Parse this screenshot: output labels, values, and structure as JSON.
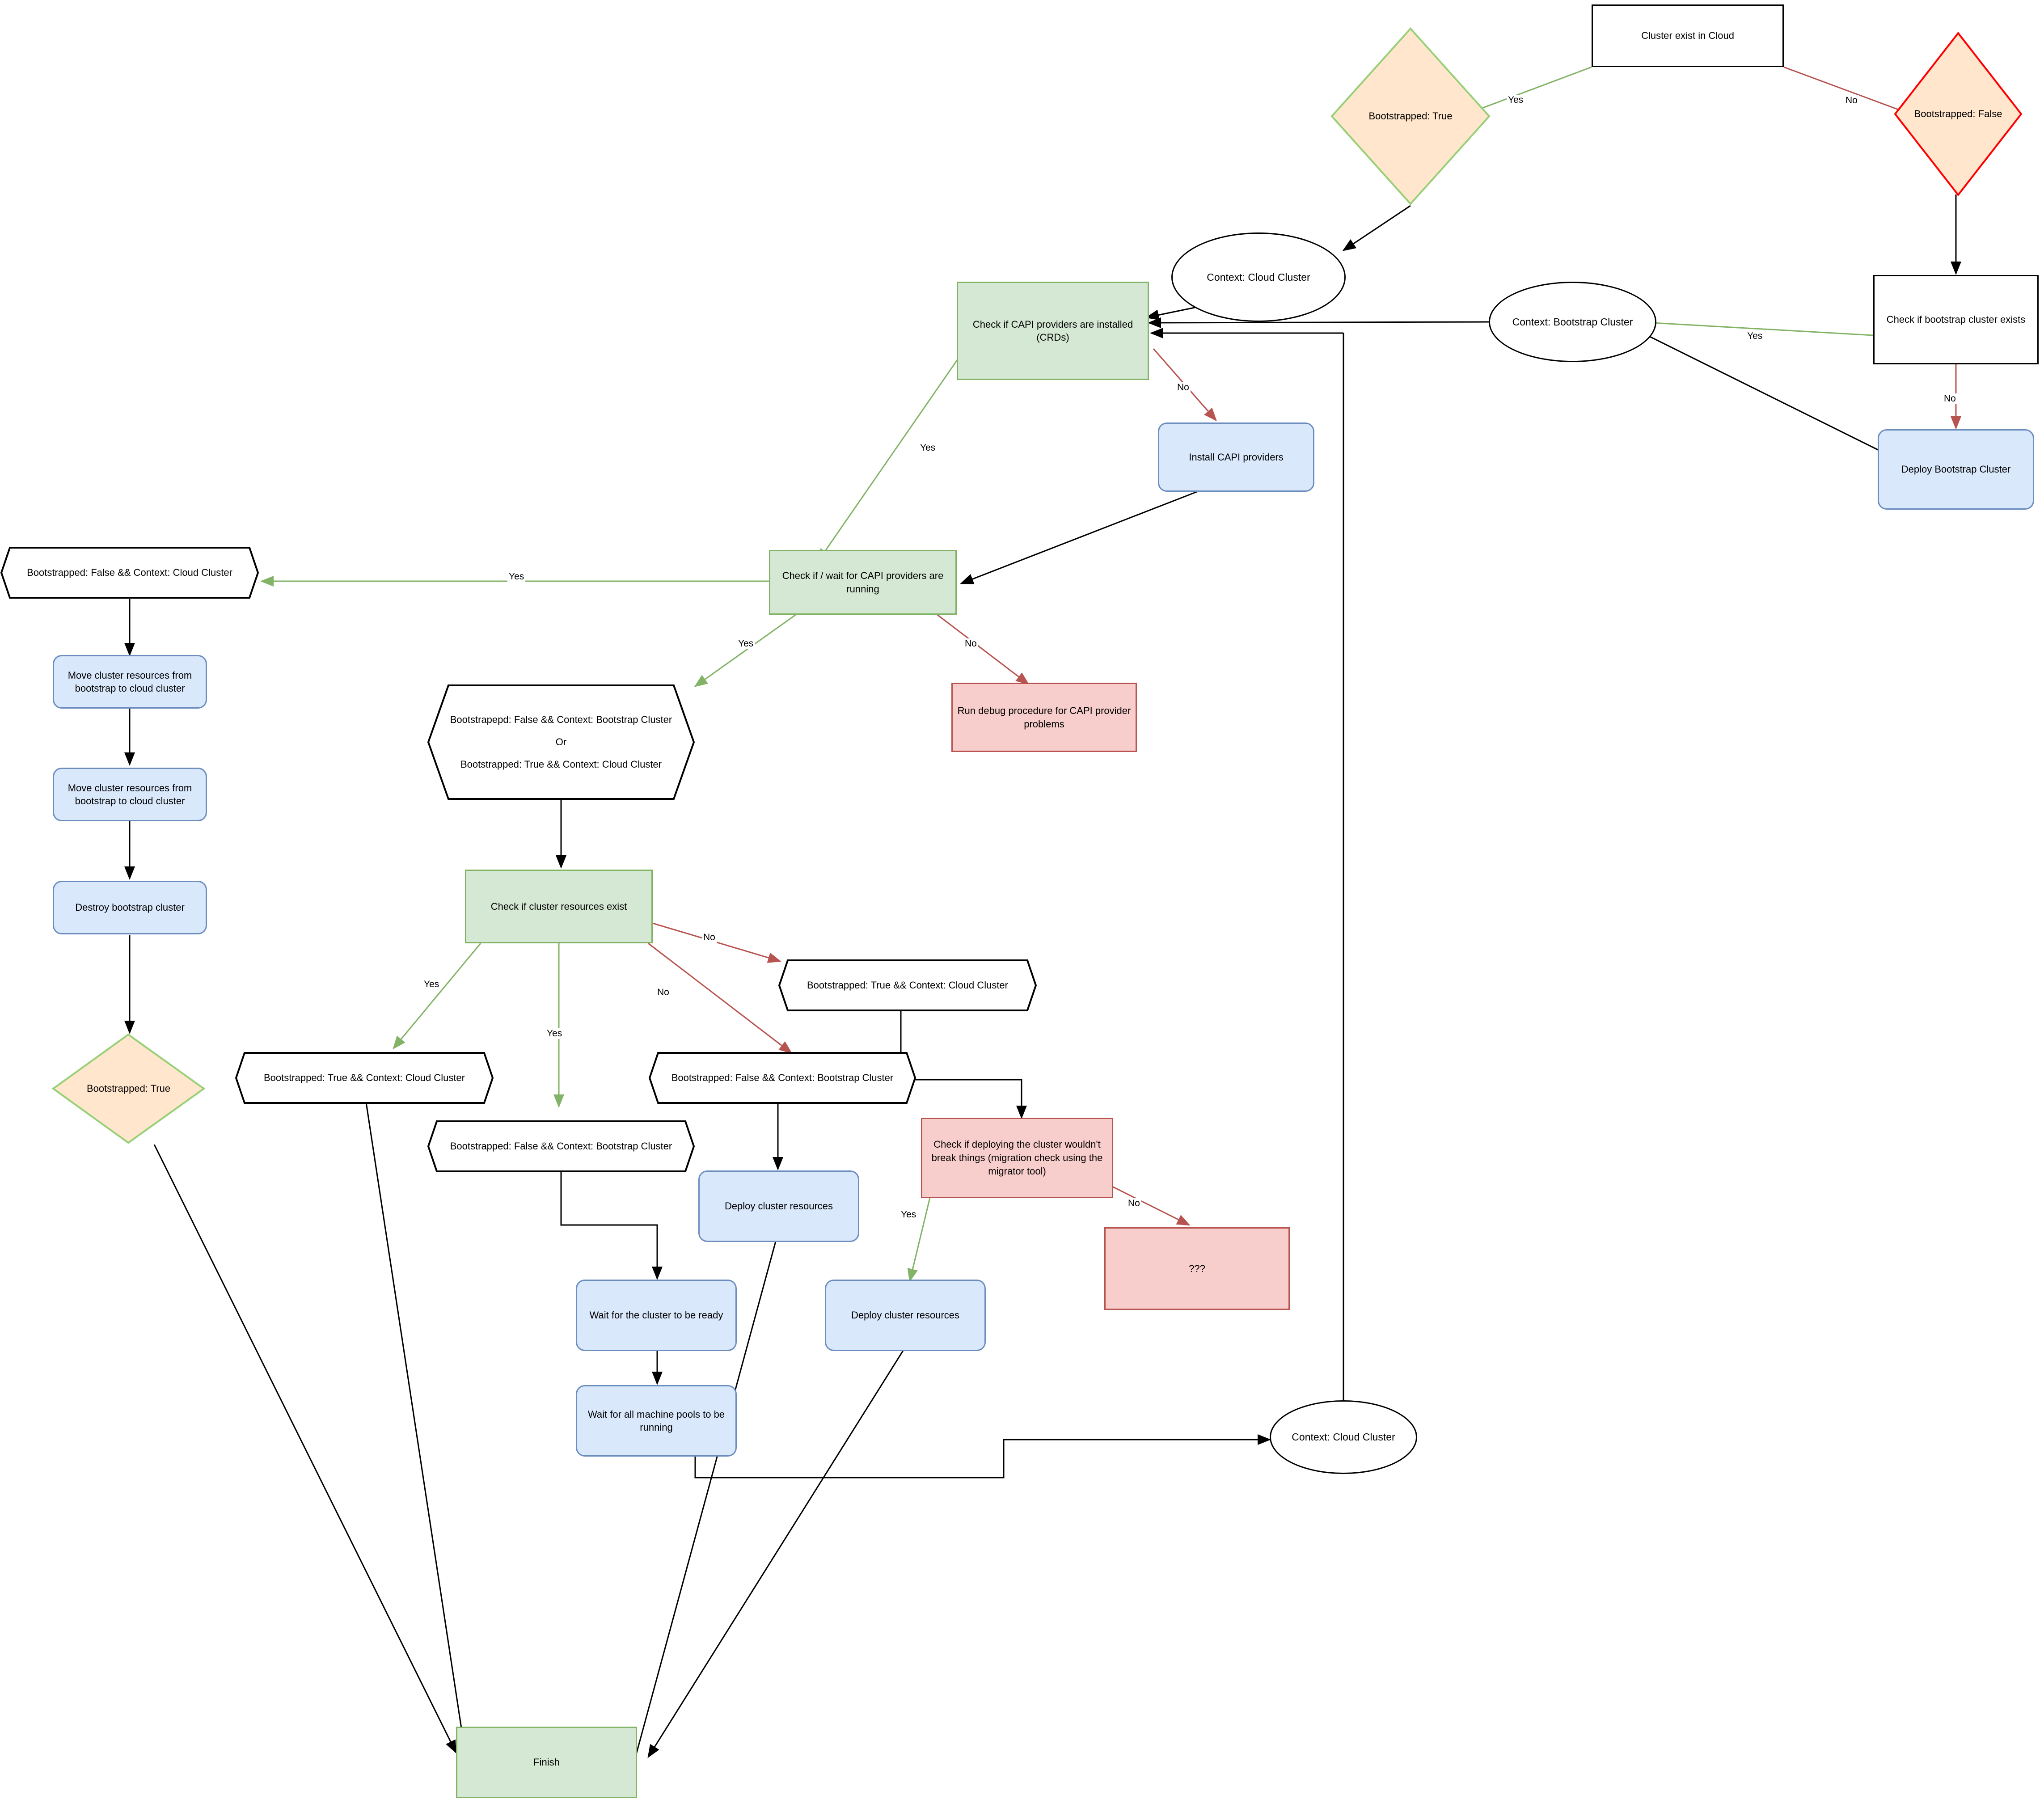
{
  "diagram": {
    "title": "Cluster bootstrap / CAPI provider decision flow",
    "colors": {
      "green_fill": "#d5e8d4",
      "green_stroke": "#82b366",
      "blue_fill": "#dae8fc",
      "blue_stroke": "#6c8ebf",
      "red_fill": "#f8cecc",
      "red_stroke": "#b85450",
      "yellow_fill": "#ffe6cc",
      "yellow_green_stroke": "#97d077",
      "yellow_red_stroke": "#ff0000",
      "plain_stroke": "#000000",
      "edge_yes": "#82b366",
      "edge_no": "#b85450",
      "edge_plain": "#000000"
    },
    "nodes": {
      "cluster_exist_in_cloud": "Cluster exist in Cloud",
      "bootstrapped_true_top": "Bootstrapped: True",
      "bootstrapped_false_top": "Bootstrapped: False",
      "context_cloud_cluster_top": "Context: Cloud Cluster",
      "context_bootstrap_cluster": "Context: Bootstrap Cluster",
      "check_bootstrap_cluster_exists": "Check if bootstrap cluster exists",
      "deploy_bootstrap_cluster": "Deploy Bootstrap Cluster",
      "check_capi_installed": "Check if CAPI providers are installed (CRDs)",
      "install_capi_providers": "Install CAPI providers",
      "check_capi_running": "Check if / wait for CAPI providers are running",
      "run_debug_procedure": "Run debug procedure for CAPI provider problems",
      "cond_false_cloud": "Bootstrapped: False && Context: Cloud Cluster",
      "move_cluster_resources_1": "Move cluster resources from bootstrap to cloud cluster",
      "move_cluster_resources_2": "Move cluster resources from bootstrap to cloud cluster",
      "destroy_bootstrap_cluster": "Destroy bootstrap cluster",
      "bootstrapped_true_bottom": "Bootstrapped: True",
      "cond_or_combo_line1": "Bootstrapepd: False && Context: Bootstrap Cluster",
      "cond_or_combo_line2": "Or",
      "cond_or_combo_line3": "Bootstrapped: True && Context: Cloud Cluster",
      "check_cluster_resources_exist": "Check if cluster resources exist",
      "cond_true_cloud_right": "Bootstrapped: True && Context: Cloud Cluster",
      "cond_true_cloud_left": "Bootstrapped: True && Context: Cloud Cluster",
      "cond_false_bootstrap_right": "Bootstrapped: False && Context: Bootstrap Cluster",
      "cond_false_bootstrap_mid": "Bootstrapped: False && Context: Bootstrap Cluster",
      "deploy_cluster_resources_1": "Deploy cluster resources",
      "deploy_cluster_resources_2": "Deploy cluster resources",
      "check_migration": "Check if deploying the cluster wouldn't break things (migration check using the migrator tool)",
      "unknown": "???",
      "wait_cluster_ready": "Wait for the cluster to be ready",
      "wait_machine_pools": "Wait for all machine pools to be running",
      "context_cloud_cluster_bottom": "Context: Cloud Cluster",
      "finish": "Finish"
    },
    "edge_labels": {
      "cloud_yes": "Yes",
      "cloud_no": "No",
      "bootstrap_exists_yes": "Yes",
      "bootstrap_exists_no": "No",
      "capi_installed_yes": "Yes",
      "capi_installed_no": "No",
      "capi_running_yes_left": "Yes",
      "capi_running_yes_down": "Yes",
      "capi_running_no": "No",
      "resources_yes_left": "Yes",
      "resources_yes_mid": "Yes",
      "resources_no_up": "No",
      "resources_no_down": "No",
      "migration_yes": "Yes",
      "migration_no": "No"
    }
  }
}
